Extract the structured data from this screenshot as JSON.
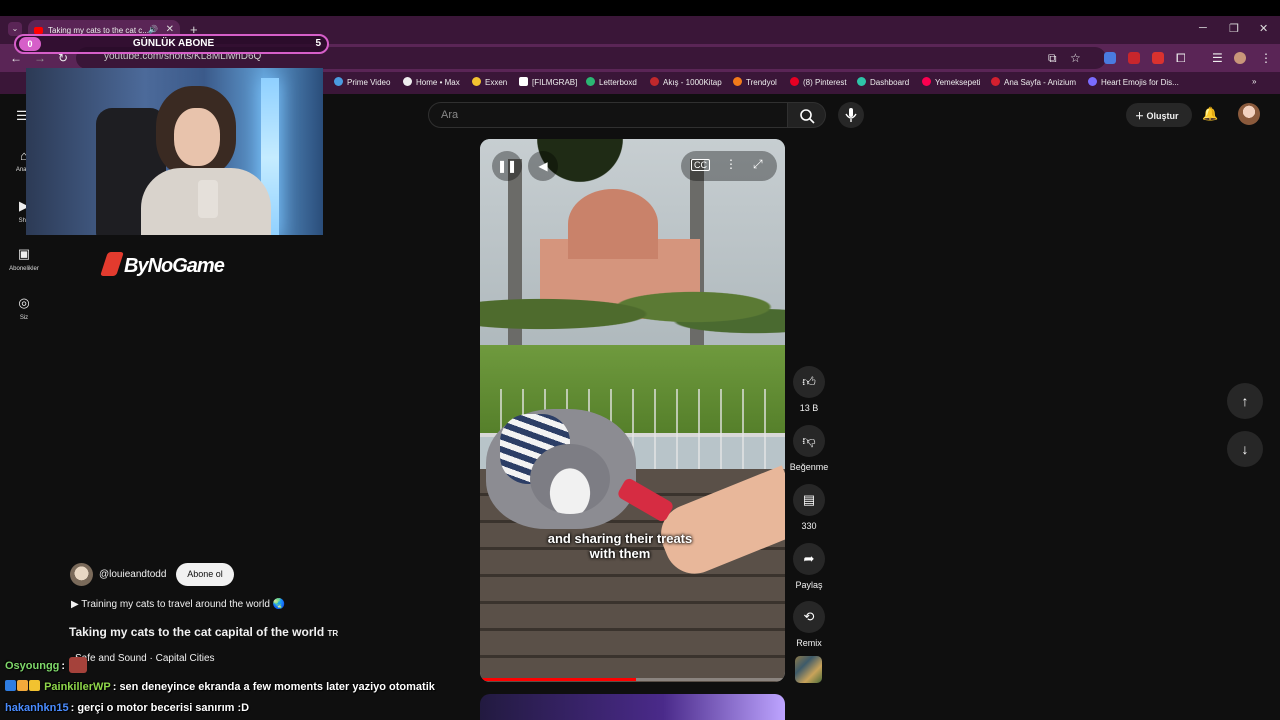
{
  "browser": {
    "tab_title": "Taking my cats to the cat c...",
    "new_tab_icon": "plus",
    "url": "youtube.com/shorts/KL8MLiwhD6Q",
    "bookmarks": [
      "Prime Video",
      "Home • Max",
      "Exxen",
      "[FILMGRAB]",
      "Letterboxd",
      "Akış - 1000Kitap",
      "Trendyol",
      "(8) Pinterest",
      "Dashboard",
      "Yemeksepeti",
      "Ana Sayfa - Anizium",
      "Heart Emojis for Dis..."
    ]
  },
  "youtube": {
    "sidebar": [
      {
        "label": "Ana S",
        "icon": "home-icon"
      },
      {
        "label": "Sho",
        "icon": "shorts-icon"
      },
      {
        "label": "Abonelikler",
        "icon": "subscriptions-icon"
      },
      {
        "label": "Siz",
        "icon": "you-icon"
      }
    ],
    "search_placeholder": "Ara",
    "create_label": "Oluştur",
    "short": {
      "caption": "and sharing their treats with them",
      "progress_pct": 51,
      "channel": "@louieandtodd",
      "subscribe_label": "Abone ol",
      "description": "▶ Training my cats to travel around the world 🌏",
      "title": "Taking my cats to the cat capital of the world",
      "title_flag": "TR",
      "sound": "Safe and Sound · Capital Cities"
    },
    "actions": [
      {
        "icon": "like-icon",
        "label": "13 B"
      },
      {
        "icon": "dislike-icon",
        "label": "Beğenme"
      },
      {
        "icon": "comment-icon",
        "label": "330"
      },
      {
        "icon": "share-icon",
        "label": "Paylaş"
      },
      {
        "icon": "remix-icon",
        "label": "Remix"
      }
    ]
  },
  "overlay": {
    "sub_widget": {
      "left_count": "0",
      "title": "GÜNLÜK ABONE",
      "right_count": "5"
    },
    "sponsor": "ByNoGame",
    "chat": [
      {
        "user": "Osyoungg",
        "user_color": "#7fd86a",
        "message": ""
      },
      {
        "user": "PainkillerWP",
        "user_color": "#8fd64a",
        "message": "sen deneyince ekranda a few moments later yaziyo otomatik"
      },
      {
        "user": "hakanhkn15",
        "user_color": "#4a8cff",
        "message": "gerçi o motor becerisi sanırım :D"
      }
    ]
  }
}
